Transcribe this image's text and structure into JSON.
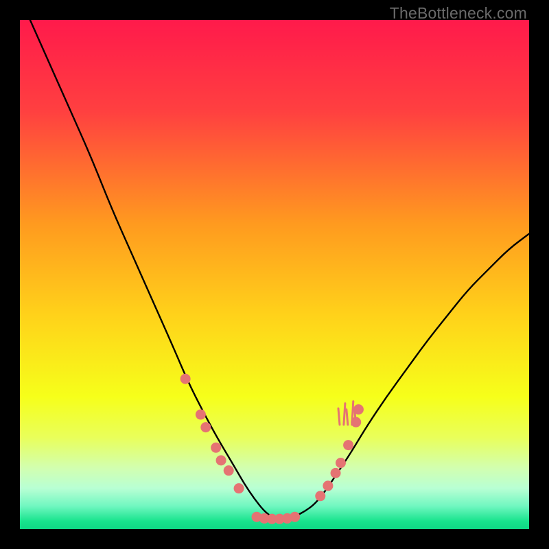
{
  "watermark": "TheBottleneck.com",
  "chart_data": {
    "type": "line",
    "title": "",
    "xlabel": "",
    "ylabel": "",
    "xlim": [
      0,
      100
    ],
    "ylim": [
      0,
      100
    ],
    "grid": false,
    "legend": false,
    "background_gradient": {
      "stops": [
        {
          "offset": 0.0,
          "color": "#ff1a4b"
        },
        {
          "offset": 0.18,
          "color": "#ff4040"
        },
        {
          "offset": 0.4,
          "color": "#ff9a1f"
        },
        {
          "offset": 0.58,
          "color": "#ffd21a"
        },
        {
          "offset": 0.74,
          "color": "#f6ff1a"
        },
        {
          "offset": 0.82,
          "color": "#e9ff5a"
        },
        {
          "offset": 0.88,
          "color": "#d2ffb0"
        },
        {
          "offset": 0.92,
          "color": "#b8ffd4"
        },
        {
          "offset": 0.955,
          "color": "#70f7c0"
        },
        {
          "offset": 0.985,
          "color": "#17e38c"
        },
        {
          "offset": 1.0,
          "color": "#0fd885"
        }
      ]
    },
    "series": [
      {
        "name": "bottleneck-curve",
        "x": [
          2,
          6,
          10,
          14,
          18,
          22,
          26,
          30,
          33,
          36,
          39,
          42,
          44,
          46,
          48,
          50,
          52,
          54,
          56,
          58,
          60,
          62,
          65,
          68,
          72,
          76,
          80,
          84,
          88,
          92,
          96,
          100
        ],
        "y": [
          100,
          91,
          82,
          73,
          63,
          54,
          45,
          36,
          29,
          23,
          17.5,
          12.5,
          9,
          6,
          3.5,
          2,
          2,
          2.5,
          3.5,
          5,
          7.5,
          10.5,
          15,
          20,
          26,
          31.5,
          37,
          42,
          47,
          51,
          55,
          58
        ]
      }
    ],
    "markers": {
      "name": "reference-gpu-points",
      "color": "#e57373",
      "points": [
        {
          "x": 32.5,
          "y": 29.5
        },
        {
          "x": 35.5,
          "y": 22.5
        },
        {
          "x": 36.5,
          "y": 20.0
        },
        {
          "x": 38.5,
          "y": 16.0
        },
        {
          "x": 39.5,
          "y": 13.5
        },
        {
          "x": 41.0,
          "y": 11.5
        },
        {
          "x": 43.0,
          "y": 8.0
        },
        {
          "x": 46.5,
          "y": 2.4
        },
        {
          "x": 48.0,
          "y": 2.1
        },
        {
          "x": 49.5,
          "y": 2.0
        },
        {
          "x": 51.0,
          "y": 2.0
        },
        {
          "x": 52.5,
          "y": 2.1
        },
        {
          "x": 54.0,
          "y": 2.4
        },
        {
          "x": 59.0,
          "y": 6.5
        },
        {
          "x": 60.5,
          "y": 8.5
        },
        {
          "x": 62.0,
          "y": 11.0
        },
        {
          "x": 63.0,
          "y": 13.0
        },
        {
          "x": 64.5,
          "y": 16.5
        },
        {
          "x": 66.0,
          "y": 21.0
        },
        {
          "x": 66.5,
          "y": 23.5
        }
      ]
    },
    "grass_accents": {
      "color": "#e57373",
      "x_positions": [
        62.8,
        63.6,
        64.4,
        65.2,
        66.0
      ],
      "base_y": 20.5,
      "heights": [
        3.2,
        4.2,
        3.0,
        4.6,
        2.8
      ]
    }
  }
}
